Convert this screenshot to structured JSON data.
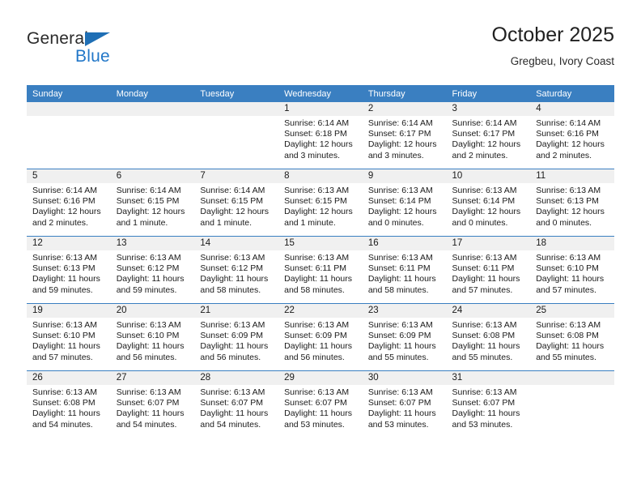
{
  "brand": {
    "name_top": "General",
    "name_bottom": "Blue",
    "triangle_color": "#1f6fb5",
    "text_color": "#2277c8"
  },
  "header": {
    "title": "October 2025",
    "location": "Gregbeu, Ivory Coast"
  },
  "theme": {
    "header_blue": "#3a7fc1",
    "daynum_band": "#f0f0f0",
    "cell_background": "#ffffff"
  },
  "weekday_headers": [
    "Sunday",
    "Monday",
    "Tuesday",
    "Wednesday",
    "Thursday",
    "Friday",
    "Saturday"
  ],
  "weeks": [
    {
      "days": [
        {
          "num": "",
          "sunrise": "",
          "sunset": "",
          "daylight_line1": "",
          "daylight_line2": ""
        },
        {
          "num": "",
          "sunrise": "",
          "sunset": "",
          "daylight_line1": "",
          "daylight_line2": ""
        },
        {
          "num": "",
          "sunrise": "",
          "sunset": "",
          "daylight_line1": "",
          "daylight_line2": ""
        },
        {
          "num": "1",
          "sunrise": "Sunrise: 6:14 AM",
          "sunset": "Sunset: 6:18 PM",
          "daylight_line1": "Daylight: 12 hours",
          "daylight_line2": "and 3 minutes."
        },
        {
          "num": "2",
          "sunrise": "Sunrise: 6:14 AM",
          "sunset": "Sunset: 6:17 PM",
          "daylight_line1": "Daylight: 12 hours",
          "daylight_line2": "and 3 minutes."
        },
        {
          "num": "3",
          "sunrise": "Sunrise: 6:14 AM",
          "sunset": "Sunset: 6:17 PM",
          "daylight_line1": "Daylight: 12 hours",
          "daylight_line2": "and 2 minutes."
        },
        {
          "num": "4",
          "sunrise": "Sunrise: 6:14 AM",
          "sunset": "Sunset: 6:16 PM",
          "daylight_line1": "Daylight: 12 hours",
          "daylight_line2": "and 2 minutes."
        }
      ]
    },
    {
      "days": [
        {
          "num": "5",
          "sunrise": "Sunrise: 6:14 AM",
          "sunset": "Sunset: 6:16 PM",
          "daylight_line1": "Daylight: 12 hours",
          "daylight_line2": "and 2 minutes."
        },
        {
          "num": "6",
          "sunrise": "Sunrise: 6:14 AM",
          "sunset": "Sunset: 6:15 PM",
          "daylight_line1": "Daylight: 12 hours",
          "daylight_line2": "and 1 minute."
        },
        {
          "num": "7",
          "sunrise": "Sunrise: 6:14 AM",
          "sunset": "Sunset: 6:15 PM",
          "daylight_line1": "Daylight: 12 hours",
          "daylight_line2": "and 1 minute."
        },
        {
          "num": "8",
          "sunrise": "Sunrise: 6:13 AM",
          "sunset": "Sunset: 6:15 PM",
          "daylight_line1": "Daylight: 12 hours",
          "daylight_line2": "and 1 minute."
        },
        {
          "num": "9",
          "sunrise": "Sunrise: 6:13 AM",
          "sunset": "Sunset: 6:14 PM",
          "daylight_line1": "Daylight: 12 hours",
          "daylight_line2": "and 0 minutes."
        },
        {
          "num": "10",
          "sunrise": "Sunrise: 6:13 AM",
          "sunset": "Sunset: 6:14 PM",
          "daylight_line1": "Daylight: 12 hours",
          "daylight_line2": "and 0 minutes."
        },
        {
          "num": "11",
          "sunrise": "Sunrise: 6:13 AM",
          "sunset": "Sunset: 6:13 PM",
          "daylight_line1": "Daylight: 12 hours",
          "daylight_line2": "and 0 minutes."
        }
      ]
    },
    {
      "days": [
        {
          "num": "12",
          "sunrise": "Sunrise: 6:13 AM",
          "sunset": "Sunset: 6:13 PM",
          "daylight_line1": "Daylight: 11 hours",
          "daylight_line2": "and 59 minutes."
        },
        {
          "num": "13",
          "sunrise": "Sunrise: 6:13 AM",
          "sunset": "Sunset: 6:12 PM",
          "daylight_line1": "Daylight: 11 hours",
          "daylight_line2": "and 59 minutes."
        },
        {
          "num": "14",
          "sunrise": "Sunrise: 6:13 AM",
          "sunset": "Sunset: 6:12 PM",
          "daylight_line1": "Daylight: 11 hours",
          "daylight_line2": "and 58 minutes."
        },
        {
          "num": "15",
          "sunrise": "Sunrise: 6:13 AM",
          "sunset": "Sunset: 6:11 PM",
          "daylight_line1": "Daylight: 11 hours",
          "daylight_line2": "and 58 minutes."
        },
        {
          "num": "16",
          "sunrise": "Sunrise: 6:13 AM",
          "sunset": "Sunset: 6:11 PM",
          "daylight_line1": "Daylight: 11 hours",
          "daylight_line2": "and 58 minutes."
        },
        {
          "num": "17",
          "sunrise": "Sunrise: 6:13 AM",
          "sunset": "Sunset: 6:11 PM",
          "daylight_line1": "Daylight: 11 hours",
          "daylight_line2": "and 57 minutes."
        },
        {
          "num": "18",
          "sunrise": "Sunrise: 6:13 AM",
          "sunset": "Sunset: 6:10 PM",
          "daylight_line1": "Daylight: 11 hours",
          "daylight_line2": "and 57 minutes."
        }
      ]
    },
    {
      "days": [
        {
          "num": "19",
          "sunrise": "Sunrise: 6:13 AM",
          "sunset": "Sunset: 6:10 PM",
          "daylight_line1": "Daylight: 11 hours",
          "daylight_line2": "and 57 minutes."
        },
        {
          "num": "20",
          "sunrise": "Sunrise: 6:13 AM",
          "sunset": "Sunset: 6:10 PM",
          "daylight_line1": "Daylight: 11 hours",
          "daylight_line2": "and 56 minutes."
        },
        {
          "num": "21",
          "sunrise": "Sunrise: 6:13 AM",
          "sunset": "Sunset: 6:09 PM",
          "daylight_line1": "Daylight: 11 hours",
          "daylight_line2": "and 56 minutes."
        },
        {
          "num": "22",
          "sunrise": "Sunrise: 6:13 AM",
          "sunset": "Sunset: 6:09 PM",
          "daylight_line1": "Daylight: 11 hours",
          "daylight_line2": "and 56 minutes."
        },
        {
          "num": "23",
          "sunrise": "Sunrise: 6:13 AM",
          "sunset": "Sunset: 6:09 PM",
          "daylight_line1": "Daylight: 11 hours",
          "daylight_line2": "and 55 minutes."
        },
        {
          "num": "24",
          "sunrise": "Sunrise: 6:13 AM",
          "sunset": "Sunset: 6:08 PM",
          "daylight_line1": "Daylight: 11 hours",
          "daylight_line2": "and 55 minutes."
        },
        {
          "num": "25",
          "sunrise": "Sunrise: 6:13 AM",
          "sunset": "Sunset: 6:08 PM",
          "daylight_line1": "Daylight: 11 hours",
          "daylight_line2": "and 55 minutes."
        }
      ]
    },
    {
      "days": [
        {
          "num": "26",
          "sunrise": "Sunrise: 6:13 AM",
          "sunset": "Sunset: 6:08 PM",
          "daylight_line1": "Daylight: 11 hours",
          "daylight_line2": "and 54 minutes."
        },
        {
          "num": "27",
          "sunrise": "Sunrise: 6:13 AM",
          "sunset": "Sunset: 6:07 PM",
          "daylight_line1": "Daylight: 11 hours",
          "daylight_line2": "and 54 minutes."
        },
        {
          "num": "28",
          "sunrise": "Sunrise: 6:13 AM",
          "sunset": "Sunset: 6:07 PM",
          "daylight_line1": "Daylight: 11 hours",
          "daylight_line2": "and 54 minutes."
        },
        {
          "num": "29",
          "sunrise": "Sunrise: 6:13 AM",
          "sunset": "Sunset: 6:07 PM",
          "daylight_line1": "Daylight: 11 hours",
          "daylight_line2": "and 53 minutes."
        },
        {
          "num": "30",
          "sunrise": "Sunrise: 6:13 AM",
          "sunset": "Sunset: 6:07 PM",
          "daylight_line1": "Daylight: 11 hours",
          "daylight_line2": "and 53 minutes."
        },
        {
          "num": "31",
          "sunrise": "Sunrise: 6:13 AM",
          "sunset": "Sunset: 6:07 PM",
          "daylight_line1": "Daylight: 11 hours",
          "daylight_line2": "and 53 minutes."
        },
        {
          "num": "",
          "sunrise": "",
          "sunset": "",
          "daylight_line1": "",
          "daylight_line2": ""
        }
      ]
    }
  ]
}
